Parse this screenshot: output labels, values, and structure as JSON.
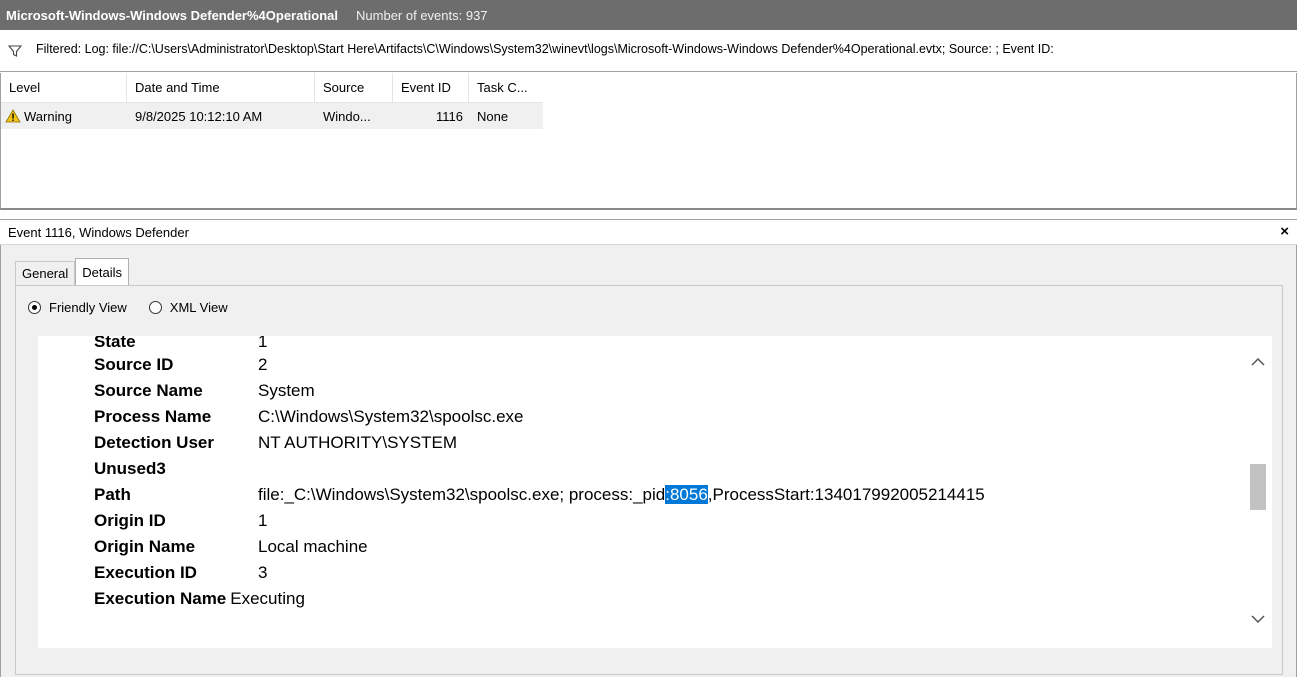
{
  "header": {
    "log_name": "Microsoft-Windows-Windows Defender%4Operational",
    "event_count": "Number of events: 937"
  },
  "filter": {
    "text": "Filtered: Log: file://C:\\Users\\Administrator\\Desktop\\Start Here\\Artifacts\\C\\Windows\\System32\\winevt\\logs\\Microsoft-Windows-Windows Defender%4Operational.evtx; Source: ; Event ID:"
  },
  "event_list": {
    "columns": [
      "Level",
      "Date and Time",
      "Source",
      "Event ID",
      "Task C..."
    ],
    "rows": [
      {
        "level": "Warning",
        "date_time": "9/8/2025 10:12:10 AM",
        "source": "Windo...",
        "event_id": "1116",
        "task_category": "None"
      }
    ]
  },
  "detail": {
    "title": "Event 1116, Windows Defender",
    "close_symbol": "×",
    "tabs": [
      "General",
      "Details"
    ],
    "active_tab": "Details",
    "view_options": [
      "Friendly View",
      "XML View"
    ],
    "selected_view": "Friendly View",
    "properties": [
      {
        "name": "State",
        "value": "1"
      },
      {
        "name": "Source ID",
        "value": "2"
      },
      {
        "name": "Source Name",
        "value": "System"
      },
      {
        "name": "Process Name",
        "value": "C:\\Windows\\System32\\spoolsc.exe"
      },
      {
        "name": "Detection User",
        "value": "NT AUTHORITY\\SYSTEM"
      },
      {
        "name": "Unused3",
        "value": ""
      },
      {
        "name": "Path",
        "value_before": "file:_C:\\Windows\\System32\\spoolsc.exe; process:_pid",
        "value_selected": ":8056",
        "value_after": ",ProcessStart:134017992005214415"
      },
      {
        "name": "Origin ID",
        "value": "1"
      },
      {
        "name": "Origin Name",
        "value": "Local machine"
      },
      {
        "name": "Execution ID",
        "value": "3"
      },
      {
        "name": "Execution Name",
        "value": "Executing"
      }
    ]
  },
  "colors": {
    "title_bar": "#6d6d6d",
    "selection": "#0078d7",
    "row_background": "#f0f0f0",
    "warning_icon": "#f5c518"
  },
  "icons": [
    "filter-funnel-icon",
    "warning-icon",
    "close-icon",
    "scroll-up-icon",
    "scroll-down-icon"
  ]
}
